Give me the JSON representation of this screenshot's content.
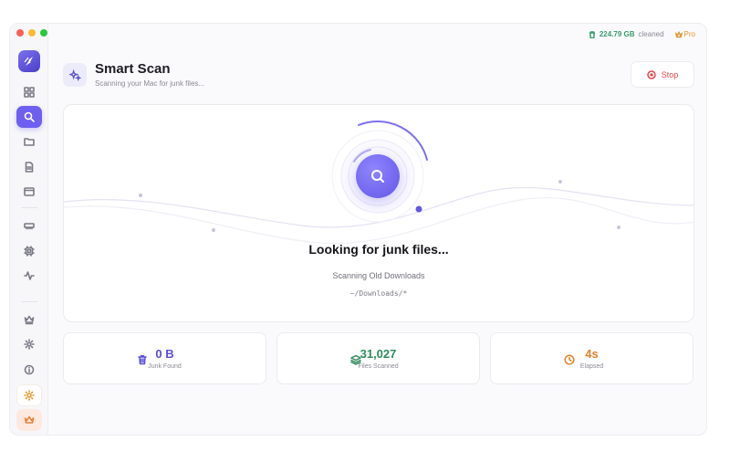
{
  "app": {
    "storage_amount": "224.79 GB",
    "storage_label": "cleaned",
    "plan_label": "Pro"
  },
  "sidebar": {
    "items": [
      {
        "name": "dashboard",
        "icon": "grid-icon"
      },
      {
        "name": "smart-scan",
        "icon": "search-icon",
        "active": true
      },
      {
        "name": "files",
        "icon": "folder-icon"
      },
      {
        "name": "documents",
        "icon": "document-icon"
      },
      {
        "name": "apps",
        "icon": "window-icon"
      },
      {
        "name": "memory",
        "icon": "memory-icon"
      },
      {
        "name": "cpu",
        "icon": "chip-icon"
      },
      {
        "name": "monitor",
        "icon": "activity-icon"
      },
      {
        "name": "premium",
        "icon": "crown-icon"
      },
      {
        "name": "settings",
        "icon": "gear-icon"
      },
      {
        "name": "about",
        "icon": "info-icon"
      },
      {
        "name": "theme",
        "icon": "sun-icon"
      },
      {
        "name": "upgrade",
        "icon": "crown-icon"
      }
    ]
  },
  "header": {
    "title": "Smart Scan",
    "subtitle": "Scanning your Mac for junk files...",
    "stop_label": "Stop"
  },
  "scan": {
    "status": "Looking for junk files...",
    "step": "Scanning Old Downloads",
    "path": "~/Downloads/*"
  },
  "stats": [
    {
      "value": "0 B",
      "label": "Junk Found",
      "color": "#5b4fd6",
      "icon": "trash-icon"
    },
    {
      "value": "31,027",
      "label": "Files Scanned",
      "color": "#2f8a5e",
      "icon": "layers-icon"
    },
    {
      "value": "4s",
      "label": "Elapsed",
      "color": "#e0822e",
      "icon": "clock-icon"
    }
  ],
  "colors": {
    "accent": "#6e5ff0",
    "danger": "#e0474a",
    "success": "#3f9b6e",
    "warning": "#e0952f"
  }
}
